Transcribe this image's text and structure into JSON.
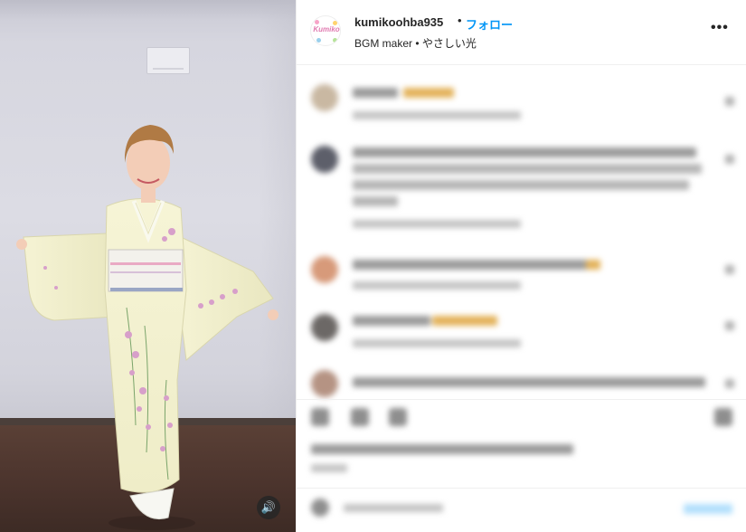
{
  "post": {
    "username": "kumikoohba935",
    "separator": "•",
    "follow_label": "フォロー",
    "subtitle": "BGM maker • やさしい光",
    "avatar_text": "Kumiko",
    "more_label": "•••",
    "mute_icon": "speaker-icon"
  },
  "comments_blurred": [
    {
      "text": "blurred comment"
    },
    {
      "text": "blurred comment"
    },
    {
      "text": "blurred comment"
    },
    {
      "text": "blurred comment"
    },
    {
      "text": "blurred comment"
    }
  ],
  "colors": {
    "follow_blue": "#0095f6",
    "text": "#262626"
  }
}
